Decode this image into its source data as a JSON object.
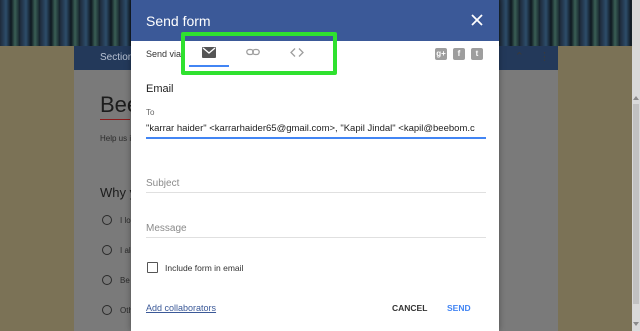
{
  "background": {
    "form_section_label": "Section",
    "form_title": "Bee",
    "help_text": "Help us i",
    "question": "Why y",
    "options": [
      "I lo",
      "I al",
      "Be",
      "Oth"
    ]
  },
  "dialog": {
    "title": "Send form",
    "send_via_label": "Send via",
    "tabs": [
      {
        "icon": "email-icon",
        "active": true
      },
      {
        "icon": "link-icon",
        "active": false
      },
      {
        "icon": "embed-code-icon",
        "active": false
      }
    ],
    "share_icons": [
      "google-plus-icon",
      "facebook-icon",
      "twitter-icon"
    ],
    "share_glyphs": {
      "google_plus": "g+",
      "facebook": "f",
      "twitter": "t"
    },
    "section_title": "Email",
    "to_label": "To",
    "to_value": "\"karrar haider\" <karrarhaider65@gmail.com>, \"Kapil Jindal\" <kapil@beebom.c",
    "subject_placeholder": "Subject",
    "message_placeholder": "Message",
    "include_form_label": "Include form in email",
    "include_form_checked": false,
    "add_collaborators_label": "Add collaborators",
    "cancel_label": "CANCEL",
    "send_label": "SEND"
  },
  "colors": {
    "header": "#3b5998",
    "accent": "#4285f4",
    "highlight": "#2fe12f"
  }
}
